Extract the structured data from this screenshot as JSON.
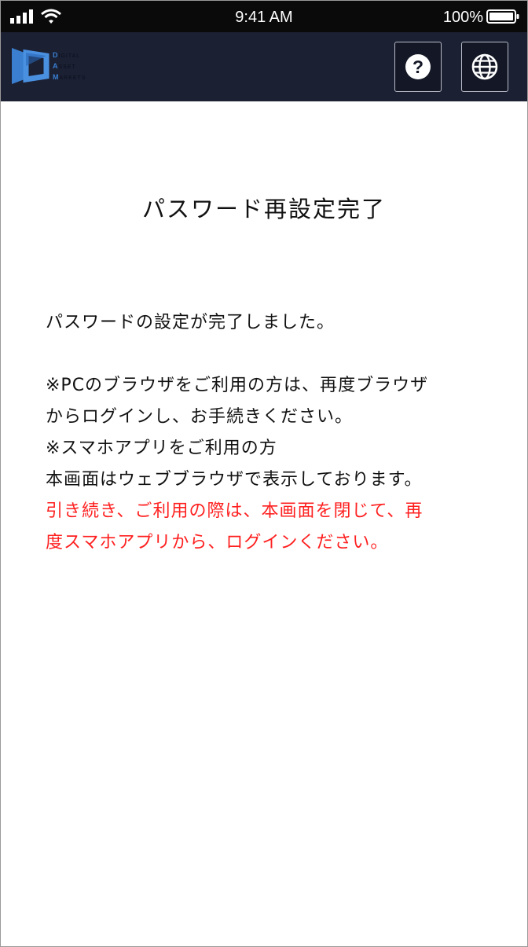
{
  "status_bar": {
    "time": "9:41 AM",
    "battery_percent": "100%",
    "icons": [
      "signal-icon",
      "wifi-icon",
      "battery-icon"
    ]
  },
  "header": {
    "logo": {
      "lines": [
        {
          "initial": "D",
          "rest": "igital"
        },
        {
          "initial": "A",
          "rest": "sset"
        },
        {
          "initial": "M",
          "rest": "arkets"
        }
      ]
    },
    "buttons": [
      {
        "icon": "help-icon",
        "label": "?"
      },
      {
        "icon": "globe-icon"
      }
    ],
    "colors": {
      "background": "#1b2033",
      "logo_accent": "#3a7fd0"
    }
  },
  "main": {
    "title": "パスワード再設定完了",
    "message": {
      "completed": "パスワードの設定が完了しました。",
      "pc_note_1": "※PCのブラウザをご利用の方は、再度ブラウザ",
      "pc_note_2": "からログインし、お手続きください。",
      "app_note_1": "※スマホアプリをご利用の方",
      "app_note_2": "本画面はウェブブラウザで表示しております。",
      "warning_1": "引き続き、ご利用の際は、本画面を閉じて、再",
      "warning_2": "度スマホアプリから、ログインください。"
    },
    "colors": {
      "text": "#111111",
      "warning": "#ff1f1f"
    }
  }
}
